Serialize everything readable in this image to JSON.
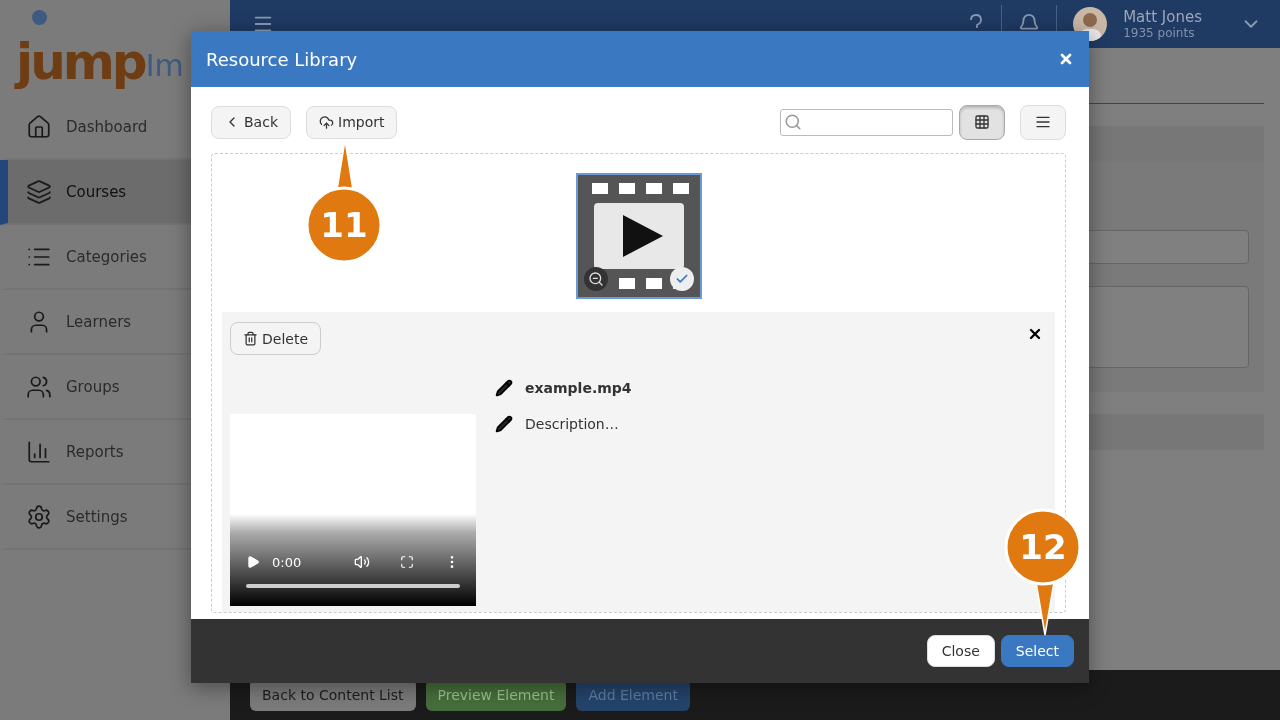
{
  "logo": {
    "text": "jump",
    "cut_text": "Im"
  },
  "sidebar": {
    "items": [
      {
        "label": "Dashboard",
        "selected": false
      },
      {
        "label": "Courses",
        "selected": true
      },
      {
        "label": "Categories",
        "selected": false
      },
      {
        "label": "Learners",
        "selected": false
      },
      {
        "label": "Groups",
        "selected": false
      },
      {
        "label": "Reports",
        "selected": false
      },
      {
        "label": "Settings",
        "selected": false
      }
    ]
  },
  "top_bar": {
    "user": {
      "name": "Matt Jones",
      "points": "1935 points"
    }
  },
  "bottom_bar": {
    "buttons": [
      {
        "label": "Back to Content List",
        "kind": "default"
      },
      {
        "label": "Preview Element",
        "kind": "success"
      },
      {
        "label": "Add Element",
        "kind": "primary"
      }
    ]
  },
  "modal": {
    "title": "Resource Library",
    "toolbar": {
      "back": "Back",
      "import": "Import",
      "views": [
        {
          "kind": "grid",
          "selected": true
        },
        {
          "kind": "list",
          "selected": false
        }
      ]
    },
    "resources": [
      {
        "kind": "video",
        "selected": true
      }
    ],
    "details": {
      "delete": "Delete",
      "title": "example.mp4",
      "description": "Description…",
      "player": {
        "time": "0:00"
      }
    },
    "footer": {
      "buttons": [
        {
          "label": "Close",
          "kind": "default"
        },
        {
          "label": "Select",
          "kind": "primary"
        }
      ]
    }
  },
  "callouts": [
    {
      "number": "11",
      "kind": "pointer-up"
    },
    {
      "number": "12",
      "kind": "pointer-down"
    }
  ]
}
